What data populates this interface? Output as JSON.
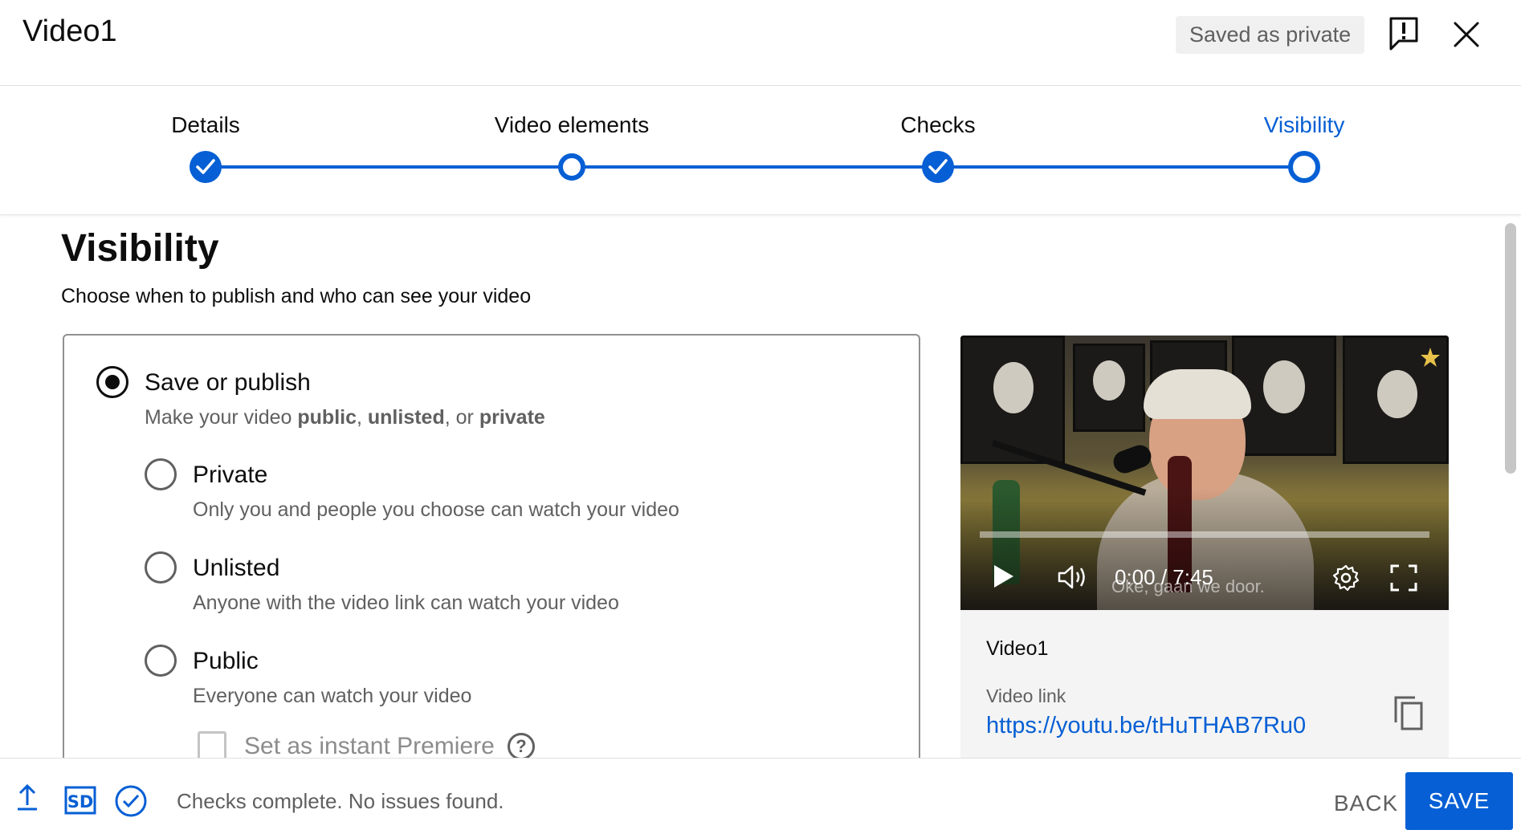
{
  "header": {
    "title": "Video1",
    "saved_status": "Saved as private",
    "feedback_icon": "feedback-icon",
    "close_icon": "close-icon"
  },
  "stepper": {
    "steps": [
      {
        "label": "Details",
        "state": "done"
      },
      {
        "label": "Video elements",
        "state": "visited"
      },
      {
        "label": "Checks",
        "state": "done"
      },
      {
        "label": "Visibility",
        "state": "active"
      }
    ],
    "accent_color": "#065fd4"
  },
  "visibility": {
    "title": "Visibility",
    "subtitle": "Choose when to publish and who can see your video",
    "save_or_publish": {
      "label": "Save or publish",
      "selected": true,
      "desc_prefix": "Make your video ",
      "desc_public": "public",
      "desc_sep1": ", ",
      "desc_unlisted": "unlisted",
      "desc_sep2": ", or ",
      "desc_private": "private"
    },
    "options": [
      {
        "label": "Private",
        "desc": "Only you and people you choose can watch your video",
        "selected": false
      },
      {
        "label": "Unlisted",
        "desc": "Anyone with the video link can watch your video",
        "selected": false
      },
      {
        "label": "Public",
        "desc": "Everyone can watch your video",
        "selected": false
      }
    ],
    "premiere": {
      "label": "Set as instant Premiere",
      "checked": false,
      "enabled": false,
      "help": "?"
    }
  },
  "preview": {
    "time": "0:00 / 7:45",
    "caption": "Oke, gaan we door.",
    "progress": 0,
    "video_title": "Video1",
    "link_label": "Video link",
    "link_url": "https://youtu.be/tHuTHAB7Ru0"
  },
  "footer": {
    "status": "Checks complete. No issues found.",
    "back_label": "BACK",
    "save_label": "SAVE",
    "icons": [
      "upload-icon",
      "sd-quality-icon",
      "check-circle-icon"
    ]
  }
}
